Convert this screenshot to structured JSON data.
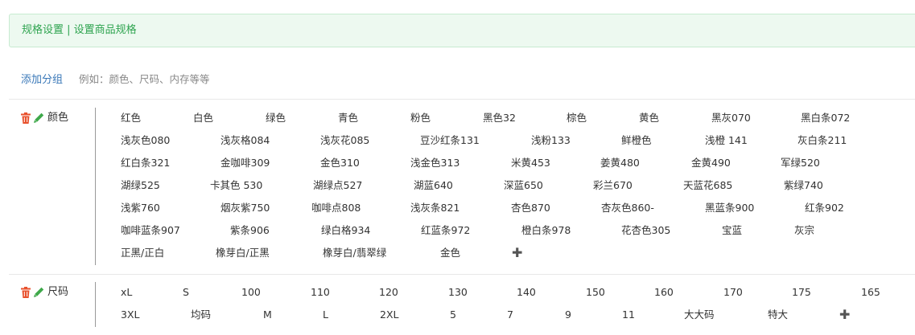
{
  "banner": {
    "title": "规格设置 | 设置商品规格"
  },
  "toolbar": {
    "add_group": "添加分组",
    "hint": "例如：颜色、尺码、内存等等"
  },
  "icons": {
    "delete": "trash-icon",
    "edit": "pencil-icon",
    "add": "plus-icon"
  },
  "colors": {
    "banner_text": "#2ea44f",
    "banner_bg": "#edf9f0",
    "link": "#3a78b8",
    "delete": "#e8512d",
    "edit": "#3fa94b"
  },
  "groups": [
    {
      "name": "颜色",
      "rows": [
        [
          "红色",
          "白色",
          "绿色",
          "青色",
          "粉色",
          "黑色32",
          "棕色",
          "黄色",
          "黑灰070",
          "黑白条072"
        ],
        [
          "浅灰色080",
          "浅灰格084",
          "浅灰花085",
          "豆沙红条131",
          "浅粉133",
          "鲜橙色",
          "浅橙 141",
          "灰白条211"
        ],
        [
          "红白条321",
          "金咖啡309",
          "金色310",
          "浅金色313",
          "米黄453",
          "姜黄480",
          "金黄490",
          "军绿520"
        ],
        [
          "湖绿525",
          "卡其色 530",
          "湖绿点527",
          "湖蓝640",
          "深蓝650",
          "彩兰670",
          "天蓝花685",
          "紫绿740"
        ],
        [
          "浅紫760",
          "烟灰紫750",
          "咖啡点808",
          "浅灰条821",
          "杏色870",
          "杏灰色860-",
          "黑蓝条900",
          "红条902"
        ],
        [
          "咖啡蓝条907",
          "紫条906",
          "绿白格934",
          "红蓝条972",
          "橙白条978",
          "花杏色305",
          "宝蓝",
          "灰宗"
        ],
        [
          "正黑/正白",
          "橡芽白/正黑",
          "橡芽白/翡翠绿",
          "金色"
        ]
      ]
    },
    {
      "name": "尺码",
      "rows": [
        [
          "xL",
          "S",
          "100",
          "110",
          "120",
          "130",
          "140",
          "150",
          "160",
          "170",
          "175",
          "165"
        ],
        [
          "3XL",
          "均码",
          "M",
          "L",
          "2XL",
          "5",
          "7",
          "9",
          "11",
          "大大码",
          "特大"
        ]
      ]
    }
  ]
}
